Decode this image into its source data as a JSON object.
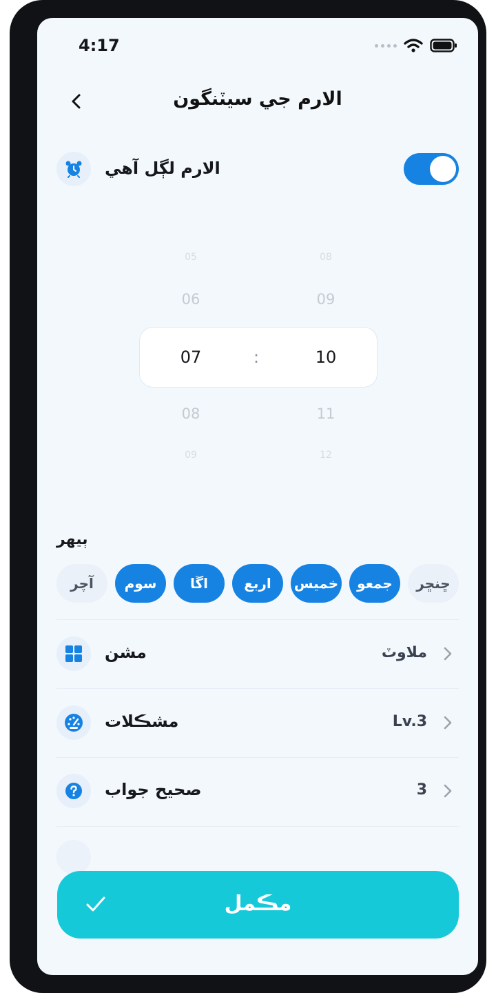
{
  "status_bar": {
    "time": "4:17"
  },
  "header": {
    "title": "الارم جي سيٽنگون"
  },
  "alarm_toggle": {
    "label": "الارم لڳل آهي",
    "on": true
  },
  "time_picker": {
    "hours": [
      "05",
      "06",
      "07",
      "08",
      "09"
    ],
    "minutes": [
      "08",
      "09",
      "10",
      "11",
      "12"
    ],
    "separator": ":",
    "selected_hour": "07",
    "selected_minute": "10"
  },
  "repeat": {
    "title": "ٻيهر",
    "days": [
      {
        "label": "آچر",
        "selected": false
      },
      {
        "label": "سوم",
        "selected": true
      },
      {
        "label": "اڱا",
        "selected": true
      },
      {
        "label": "اربع",
        "selected": true
      },
      {
        "label": "خميس",
        "selected": true
      },
      {
        "label": "جمعو",
        "selected": true
      },
      {
        "label": "ڇنڇر",
        "selected": false
      }
    ]
  },
  "settings": [
    {
      "label": "مشن",
      "value": "ملاوٽ",
      "icon": "grid-icon"
    },
    {
      "label": "مشڪلات",
      "value": "Lv.3",
      "icon": "gauge-icon"
    },
    {
      "label": "صحيح جواب",
      "value": "3",
      "icon": "question-icon"
    }
  ],
  "done_button": {
    "label": "مڪمل"
  },
  "colors": {
    "accent": "#1683e3",
    "done": "#16c9d9",
    "background": "#f3f8fc"
  }
}
